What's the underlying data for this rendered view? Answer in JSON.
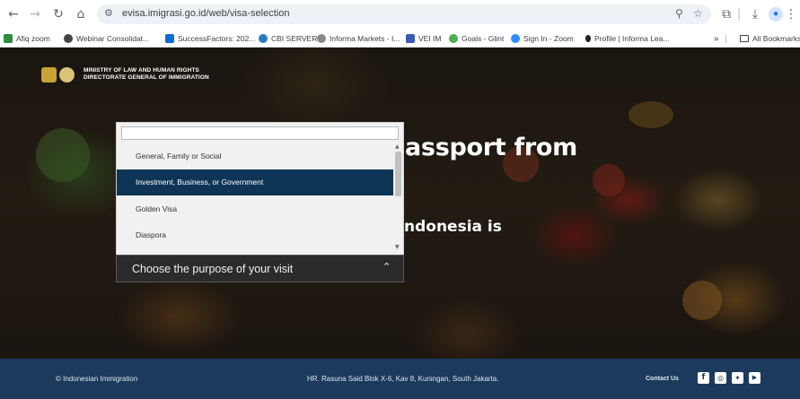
{
  "browser": {
    "url": "evisa.imigrasi.go.id/web/visa-selection",
    "bookmarks": [
      {
        "label": "Afiq zoom",
        "color": "#2d8c3c"
      },
      {
        "label": "Webinar Consolidat...",
        "color": "#444444"
      },
      {
        "label": "SuccessFactors: 202...",
        "color": "#0a6ed1"
      },
      {
        "label": "CBI SERVER",
        "color": "#2a7abf"
      },
      {
        "label": "Informa Markets - I...",
        "color": "#8a8a8a"
      },
      {
        "label": "VEI IM",
        "color": "#3b5bb5"
      },
      {
        "label": "Goals - Glint",
        "color": "#4caf50"
      },
      {
        "label": "Sign In - Zoom",
        "color": "#2d8cff"
      },
      {
        "label": "Profile | Informa Lea...",
        "color": "#222222"
      }
    ],
    "overflow_label": "»",
    "all_bookmarks_label": "All Bookmarks"
  },
  "site": {
    "ministry_line1": "MINISTRY OF LAW AND HUMAN RIGHTS",
    "ministry_line2": "DIRECTORATE GENERAL OF IMMIGRATION",
    "hero_line1": "assport from",
    "hero_line2": "ndonesia is"
  },
  "dropdown": {
    "search_value": "",
    "options": [
      {
        "label": "General, Family or Social",
        "selected": false
      },
      {
        "label": "Investment, Business, or Government",
        "selected": true
      },
      {
        "label": "Golden Visa",
        "selected": false
      },
      {
        "label": "Diaspora",
        "selected": false
      }
    ],
    "placeholder": "Choose the purpose of your visit"
  },
  "footer": {
    "copyright": "© Indonesian Immigration",
    "address": "HR. Rasuna Said Blok X-6, Kav 8, Kuningan, South Jakarta.",
    "contact_label": "Contact Us",
    "social": [
      "facebook-icon",
      "instagram-icon",
      "twitter-icon",
      "youtube-icon"
    ]
  }
}
